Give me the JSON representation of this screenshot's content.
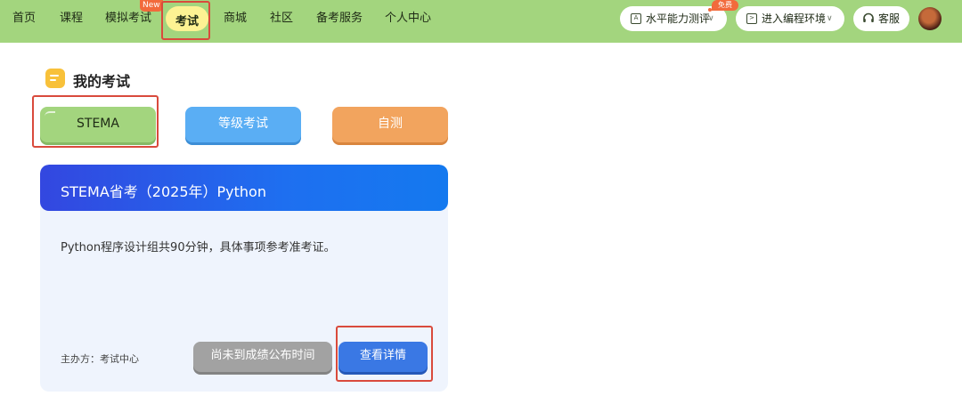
{
  "nav": {
    "items": [
      "首页",
      "课程",
      "模拟考试",
      "考试",
      "商城",
      "社区",
      "备考服务",
      "个人中心"
    ],
    "active_index": 3,
    "new_badge": "New"
  },
  "right_tools": {
    "assessment_label": "水平能力测评",
    "free_badge": "免费",
    "coding_env_label": "进入编程环境",
    "support_label": "客服"
  },
  "section": {
    "title": "我的考试"
  },
  "categories": [
    "STEMA",
    "等级考试",
    "自测"
  ],
  "exam_card": {
    "title": "STEMA省考（2025年）Python",
    "description": "Python程序设计组共90分钟，具体事项参考准考证。",
    "organizer": "主办方：考试中心",
    "score_button": "尚未到成绩公布时间",
    "detail_button": "查看详情"
  },
  "colors": {
    "topbar": "#a3d57e",
    "active_tab": "#fdf293",
    "highlight_box": "#d94a3c",
    "card_header_start": "#3347e0",
    "card_header_end": "#1479ef",
    "detail_button": "#3a78e4"
  }
}
